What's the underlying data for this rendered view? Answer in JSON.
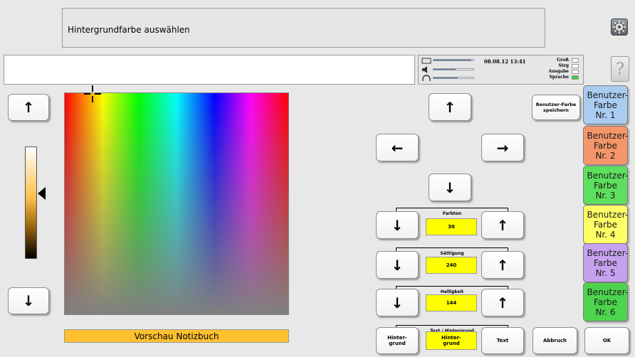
{
  "header": {
    "title": "Hintergrundfarbe auswählen",
    "input_value": ""
  },
  "status": {
    "datetime": "08.08.12 13:41",
    "levels": [
      0.95,
      0.55,
      0.6
    ],
    "indicators": [
      {
        "label": "Groß",
        "on": false
      },
      {
        "label": "Strg",
        "on": false
      },
      {
        "label": "Ausgabe",
        "on": false
      },
      {
        "label": "Sprache",
        "on": true
      }
    ]
  },
  "icons": {
    "settings": "gear-icon",
    "help": "?"
  },
  "arrows": {
    "up": "↑",
    "down": "↓",
    "left": "←",
    "right": "→"
  },
  "preview": {
    "label": "Vorschau Notizbuch"
  },
  "save_button": "Benutzer-Farbe speichern",
  "controls": {
    "hue": {
      "label": "Farbton",
      "value": "30"
    },
    "saturation": {
      "label": "Sättigung",
      "value": "240"
    },
    "brightness": {
      "label": "Helligkeit",
      "value": "144"
    },
    "target": {
      "label": "Text / Hintergrund",
      "options": [
        "Hinter-grund",
        "Hinter-grund",
        "Text"
      ]
    }
  },
  "buttons": {
    "cancel": "Abbruch",
    "ok": "OK"
  },
  "user_colors": [
    {
      "label": "Benutzer-Farbe Nr. 1",
      "color": "#a9ccf0"
    },
    {
      "label": "Benutzer-Farbe Nr. 2",
      "color": "#f4966a"
    },
    {
      "label": "Benutzer-Farbe Nr. 3",
      "color": "#5de05d"
    },
    {
      "label": "Benutzer-Farbe Nr. 4",
      "color": "#ffff66"
    },
    {
      "label": "Benutzer-Farbe Nr. 5",
      "color": "#c6a2ee"
    },
    {
      "label": "Benutzer-Farbe Nr. 6",
      "color": "#4dd44d"
    }
  ]
}
